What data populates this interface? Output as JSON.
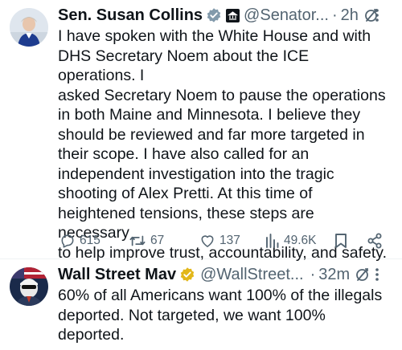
{
  "tweets": [
    {
      "author": "Sen. Susan Collins",
      "handle": "@Senator...",
      "dot": "·",
      "time": "2h",
      "text": "I have spoken with the White House and with\nDHS Secretary Noem about the ICE operations. I\nasked Secretary Noem to pause the operations\nin both Maine and Minnesota. I believe they\nshould be reviewed and far more targeted in\ntheir scope. I have also called for an\nindependent investigation into the tragic\nshooting of Alex Pretti. At this time of\nheightened tensions, these steps are necessary\nto help improve trust, accountability, and safety.",
      "replies": "615",
      "reposts": "67",
      "likes": "137",
      "views": "49.6K"
    },
    {
      "author": "Wall Street Mav",
      "handle": "@WallStreet...",
      "dot": "·",
      "time": "32m",
      "text": "60% of all Americans want 100% of the illegals\ndeported. Not targeted, we want 100%\ndeported."
    }
  ],
  "colors": {
    "gray_badge": "#829aab",
    "gold_badge": "#e2b719",
    "text": "#0f1419",
    "muted": "#536471"
  }
}
